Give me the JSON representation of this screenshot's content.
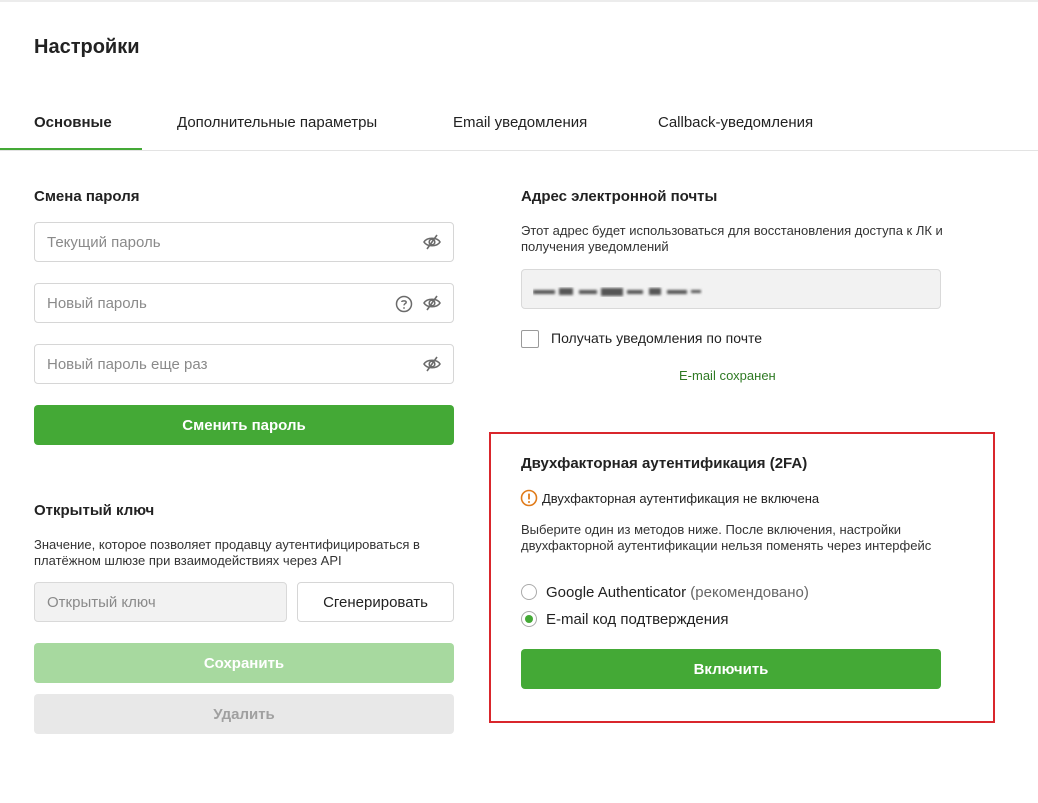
{
  "page": {
    "title": "Настройки"
  },
  "tabs": [
    {
      "label": "Основные",
      "active": true
    },
    {
      "label": "Дополнительные параметры"
    },
    {
      "label": "Email уведомления"
    },
    {
      "label": "Callback-уведомления"
    }
  ],
  "password": {
    "title": "Смена пароля",
    "current_placeholder": "Текущий пароль",
    "new_placeholder": "Новый пароль",
    "repeat_placeholder": "Новый пароль еще раз",
    "submit_label": "Сменить пароль"
  },
  "public_key": {
    "title": "Открытый ключ",
    "description": "Значение, которое позволяет продавцу аутентифицироваться в платёжном шлюзе при взаимодействиях через API",
    "input_placeholder": "Открытый ключ",
    "generate_label": "Сгенерировать",
    "save_label": "Сохранить",
    "delete_label": "Удалить"
  },
  "email": {
    "title": "Адрес электронной почты",
    "description": "Этот адрес будет использоваться для восстановления доступа к ЛК и получения уведомлений",
    "checkbox_label": "Получать уведомления по почте",
    "saved_message": "E-mail сохранен"
  },
  "two_factor": {
    "title": "Двухфакторная аутентификация (2FA)",
    "status": "Двухфакторная аутентификация не включена",
    "description": "Выберите один из методов ниже. После включения, настройки двухфакторной аутентификации нельзя поменять через интерфейс",
    "options": [
      {
        "label": "Google Authenticator",
        "hint": "(рекомендовано)",
        "selected": false
      },
      {
        "label": "E-mail код подтверждения",
        "selected": true
      }
    ],
    "enable_label": "Включить"
  },
  "colors": {
    "accent": "#44a936",
    "highlight_border": "#d9262c",
    "warning": "#e07b1a"
  }
}
